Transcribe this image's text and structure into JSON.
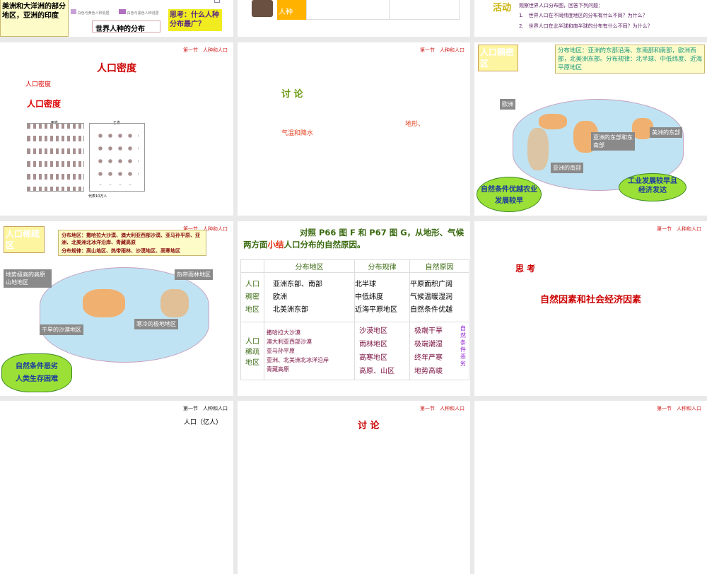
{
  "row1": {
    "s1": {
      "yellow_text": "撒哈拉以南的非洲、美洲和大洋洲的部分地区，亚洲的印度",
      "legend1": "白色与黄色人种混居",
      "legend2": "白色与黑色人种混居",
      "caption": "世界人种的分布",
      "think": "思考：什么人种分布最广？"
    },
    "s2": {
      "label": "人种"
    },
    "s3": {
      "activity": "活动",
      "intro": "观察世界人口分布图，回答下列问题：",
      "q1": "1.　世界人口在不同纬度地区的分布有什么不同？为什么？",
      "q2": "2.　世界人口在北半球和南半球的分布有什么不同？为什么？"
    }
  },
  "header": "第一节　人种和人口",
  "density": {
    "title": "人口密度",
    "sub1": "人口密度",
    "sub2": "人口密度",
    "left_label": "甲省",
    "right_label": "乙省",
    "legend": "代表10万人"
  },
  "discuss": {
    "title": "讨 论",
    "t1": "地形、",
    "t2": "气温和降水"
  },
  "dense": {
    "tag": "人口稠密区",
    "info": "分布地区：亚洲的东部沿海、东南部和南部，欧洲西部，北美洲东部。分布规律：北半球、中低纬度、近海平原地区",
    "l_europe": "欧洲",
    "l_east": "亚洲的东部和东南部",
    "l_south": "亚洲的南部",
    "l_america": "美洲的东部",
    "g1": "自然条件优越农业发展较早",
    "g2": "工业发展较早且经济发达"
  },
  "sparse": {
    "tag": "人口稀疏区",
    "info1": "分布地区：撒哈拉大沙漠、澳大利亚西部沙漠、亚马孙平原、亚洲、北美洲北冰洋沿岸、青藏高原",
    "info2": "分布规律：高山地区、热带雨林、沙漠地区、高寒地区",
    "l_plateau": "地势极高的高原山地地区",
    "l_rain": "热带雨林地区",
    "l_desert": "干旱的沙漠地区",
    "l_cold": "寒冷的极地地区",
    "cloud1": "自然条件恶劣",
    "cloud2": "人类生存困难"
  },
  "summary": {
    "title_a": "对照 P66 图 F 和 P67 图 G，从地形、气候两方面",
    "title_hl": "小结",
    "title_b": "人口分布的自然原因。",
    "headers": [
      "分布地区",
      "分布规律",
      "自然原因"
    ],
    "dense_label": "人口稠密地区",
    "dense_areas": [
      "亚洲东部、南部",
      "欧洲",
      "北美洲东部"
    ],
    "dense_rules": [
      "北半球",
      "中低纬度",
      "近海平原地区"
    ],
    "dense_causes": [
      "平原面积广阔",
      "气候温暖湿润",
      "自然条件优越"
    ],
    "sparse_label": "人口稀疏地区",
    "sparse_areas": [
      "撒哈拉大沙漠",
      "澳大利亚西部沙漠",
      "亚马孙平原",
      "亚洲、北美洲北冰洋沿岸",
      "青藏高原"
    ],
    "sparse_rules": [
      "沙漠地区",
      "雨林地区",
      "高寒地区",
      "高原、山区"
    ],
    "sparse_causes": [
      "极端干旱",
      "极端潮湿",
      "终年严寒",
      "地势高峻"
    ],
    "sparse_note": "自然条件恶劣"
  },
  "think": {
    "title": "思 考",
    "body": "自然因素和社会经济因素"
  },
  "row4": {
    "s1": "人口（亿人）",
    "s2": "讨 论"
  }
}
